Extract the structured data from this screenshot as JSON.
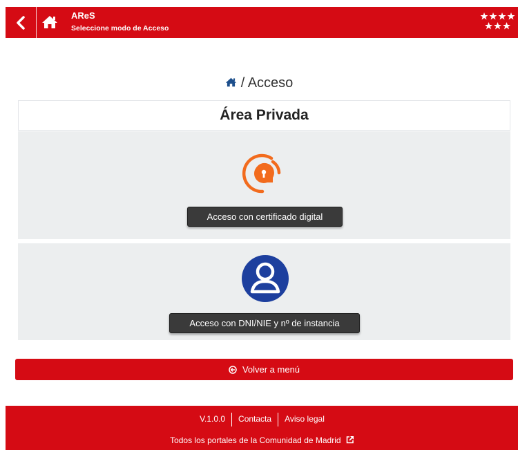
{
  "header": {
    "title": "AReS",
    "subtitle": "Seleccione modo de Acceso",
    "back_icon": "chevron-left-icon",
    "home_icon": "home-icon",
    "logo": "stars-logo"
  },
  "breadcrumb": {
    "home_icon": "home-icon",
    "separator": "/",
    "current": "Acceso"
  },
  "panel": {
    "title": "Área Privada"
  },
  "options": [
    {
      "icon": "certificate-icon",
      "label": "Acceso con certificado digital",
      "icon_color": "#f26b1d"
    },
    {
      "icon": "user-icon",
      "label": "Acceso con DNI/NIE y nº de instancia",
      "icon_color": "#1d3f9e"
    }
  ],
  "back_button": {
    "label": "Volver a menú",
    "icon": "circle-arrow-left-icon"
  },
  "footer": {
    "version": "V.1.0.0",
    "contact": "Contacta",
    "legal": "Aviso legal",
    "portals": "Todos los portales de la Comunidad de Madrid",
    "external_icon": "external-link-icon"
  },
  "colors": {
    "brand_red": "#d50b14",
    "card_bg": "#eceeef",
    "dark_button": "#3a3a3a"
  }
}
